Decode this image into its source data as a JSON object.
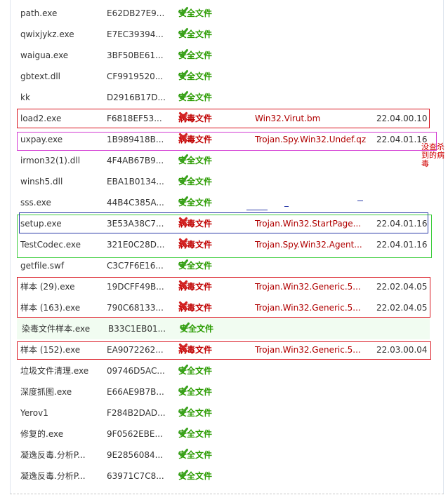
{
  "rows": [
    {
      "name": "path.exe",
      "hash": "E62DB27E9...",
      "status": "安全文件",
      "safe": true,
      "virus": "",
      "date": ""
    },
    {
      "name": "qwixjykz.exe",
      "hash": "E7EC39394...",
      "status": "安全文件",
      "safe": true,
      "virus": "",
      "date": ""
    },
    {
      "name": "waigua.exe",
      "hash": "3BF50BE61...",
      "status": "安全文件",
      "safe": true,
      "virus": "",
      "date": ""
    },
    {
      "name": "gbtext.dll",
      "hash": "CF9919520...",
      "status": "安全文件",
      "safe": true,
      "virus": "",
      "date": ""
    },
    {
      "name": "kk",
      "hash": "D2916B17D...",
      "status": "安全文件",
      "safe": true,
      "virus": "",
      "date": ""
    },
    {
      "name": "load2.exe",
      "hash": "F6818EF53...",
      "status": "病毒文件",
      "safe": false,
      "virus": "Win32.Virut.bm",
      "date": "22.04.00.10"
    },
    {
      "name": "uxpay.exe",
      "hash": "1B989418B...",
      "status": "病毒文件",
      "safe": false,
      "virus": "Trojan.Spy.Win32.Undef.qz",
      "date": "22.04.01.16"
    },
    {
      "name": "irmon32(1).dll",
      "hash": "4F4AB67B9...",
      "status": "安全文件",
      "safe": true,
      "virus": "",
      "date": ""
    },
    {
      "name": "winsh5.dll",
      "hash": "EBA1B0134...",
      "status": "安全文件",
      "safe": true,
      "virus": "",
      "date": ""
    },
    {
      "name": "sss.exe",
      "hash": "44B4C385A...",
      "status": "安全文件",
      "safe": true,
      "virus": "",
      "date": ""
    },
    {
      "name": "setup.exe",
      "hash": "3E53A38C7...",
      "status": "病毒文件",
      "safe": false,
      "virus": "Trojan.Win32.StartPage...",
      "date": "22.04.01.16"
    },
    {
      "name": "TestCodec.exe",
      "hash": "321E0C28D...",
      "status": "病毒文件",
      "safe": false,
      "virus": "Trojan.Spy.Win32.Agent...",
      "date": "22.04.01.16"
    },
    {
      "name": "getfile.swf",
      "hash": "C3C7F6E16...",
      "status": "安全文件",
      "safe": true,
      "virus": "",
      "date": ""
    },
    {
      "name": "样本 (29).exe",
      "hash": "19DCFF49B...",
      "status": "病毒文件",
      "safe": false,
      "virus": "Trojan.Win32.Generic.5...",
      "date": "22.02.04.05"
    },
    {
      "name": "样本 (163).exe",
      "hash": "790C68133...",
      "status": "病毒文件",
      "safe": false,
      "virus": "Trojan.Win32.Generic.5...",
      "date": "22.02.04.05"
    },
    {
      "name": "染毒文件样本.exe",
      "hash": "B33C1EB01...",
      "status": "安全文件",
      "safe": true,
      "virus": "",
      "date": ""
    },
    {
      "name": "样本 (152).exe",
      "hash": "EA9072262...",
      "status": "病毒文件",
      "safe": false,
      "virus": "Trojan.Win32.Generic.5...",
      "date": "22.03.00.04"
    },
    {
      "name": "垃圾文件清理.exe",
      "hash": "09746D5AC...",
      "status": "安全文件",
      "safe": true,
      "virus": "",
      "date": ""
    },
    {
      "name": "深度抓图.exe",
      "hash": "E66AE9B7B...",
      "status": "安全文件",
      "safe": true,
      "virus": "",
      "date": ""
    },
    {
      "name": "Yerov1",
      "hash": "F284B2DAD...",
      "status": "安全文件",
      "safe": true,
      "virus": "",
      "date": ""
    },
    {
      "name": "修复的.exe",
      "hash": "9F0562EBE...",
      "status": "安全文件",
      "safe": true,
      "virus": "",
      "date": ""
    },
    {
      "name": "凝逸反毒.分析P...",
      "hash": "9E2856084...",
      "status": "安全文件",
      "safe": true,
      "virus": "",
      "date": ""
    },
    {
      "name": "凝逸反毒.分析P...",
      "hash": "63971C7C8...",
      "status": "安全文件",
      "safe": true,
      "virus": "",
      "date": ""
    }
  ],
  "annotation": "没查杀到的病毒",
  "colors": {
    "safe": "#2a9b00",
    "virus": "#c00000",
    "highlight_row": "#f1fcf1",
    "red_box": "#d9141e",
    "magenta_box": "#d33ad3",
    "blue_box": "#2a3aa8",
    "green_box": "#3fce3f"
  },
  "icons": {
    "safe": "green-check-icon",
    "virus": "red-x-icon"
  }
}
